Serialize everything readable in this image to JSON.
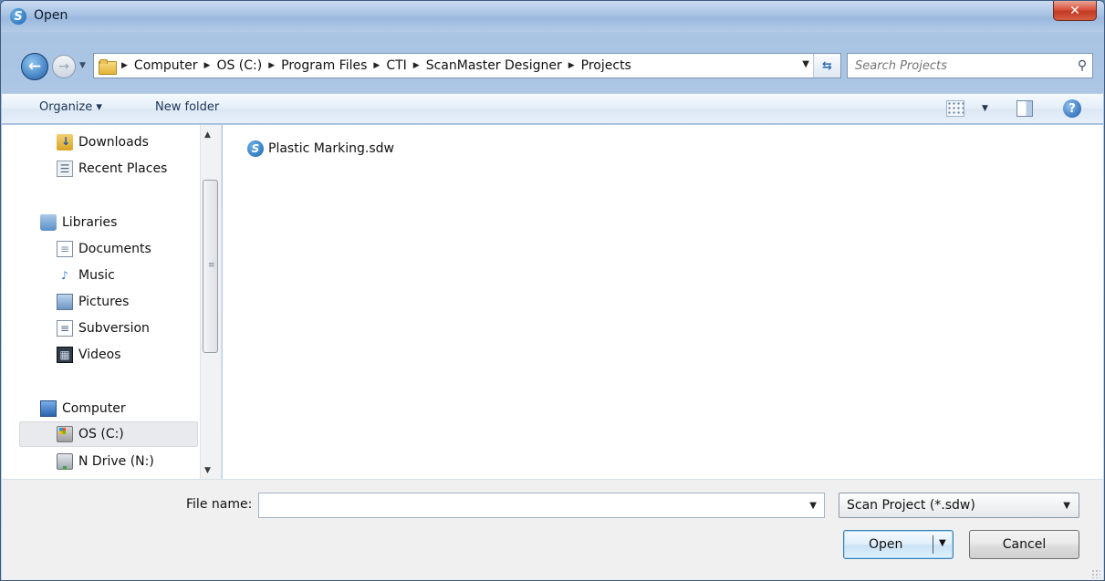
{
  "window": {
    "title": "Open"
  },
  "address": {
    "crumbs": [
      "Computer",
      "OS (C:)",
      "Program Files",
      "CTI",
      "ScanMaster Designer",
      "Projects"
    ]
  },
  "search": {
    "placeholder": "Search Projects"
  },
  "toolbar": {
    "organize_label": "Organize ▾",
    "new_folder_label": "New folder"
  },
  "nav": {
    "items": [
      {
        "label": "Downloads",
        "icon": "downloads-icon"
      },
      {
        "label": "Recent Places",
        "icon": "recent-places-icon"
      },
      {
        "label": "Libraries",
        "icon": "libraries-icon"
      },
      {
        "label": "Documents",
        "icon": "documents-icon"
      },
      {
        "label": "Music",
        "icon": "music-icon"
      },
      {
        "label": "Pictures",
        "icon": "pictures-icon"
      },
      {
        "label": "Subversion",
        "icon": "subversion-icon"
      },
      {
        "label": "Videos",
        "icon": "videos-icon"
      },
      {
        "label": "Computer",
        "icon": "computer-icon"
      },
      {
        "label": "OS (C:)",
        "icon": "hard-drive-icon"
      },
      {
        "label": "N Drive (N:)",
        "icon": "network-drive-icon"
      }
    ],
    "selected": "OS (C:)"
  },
  "files": [
    {
      "name": "Plastic Marking.sdw",
      "icon": "scanmaster-file-icon"
    }
  ],
  "bottom": {
    "file_name_label": "File name:",
    "file_name_value": "",
    "file_type": "Scan Project (*.sdw)",
    "open_label": "Open",
    "cancel_label": "Cancel"
  }
}
